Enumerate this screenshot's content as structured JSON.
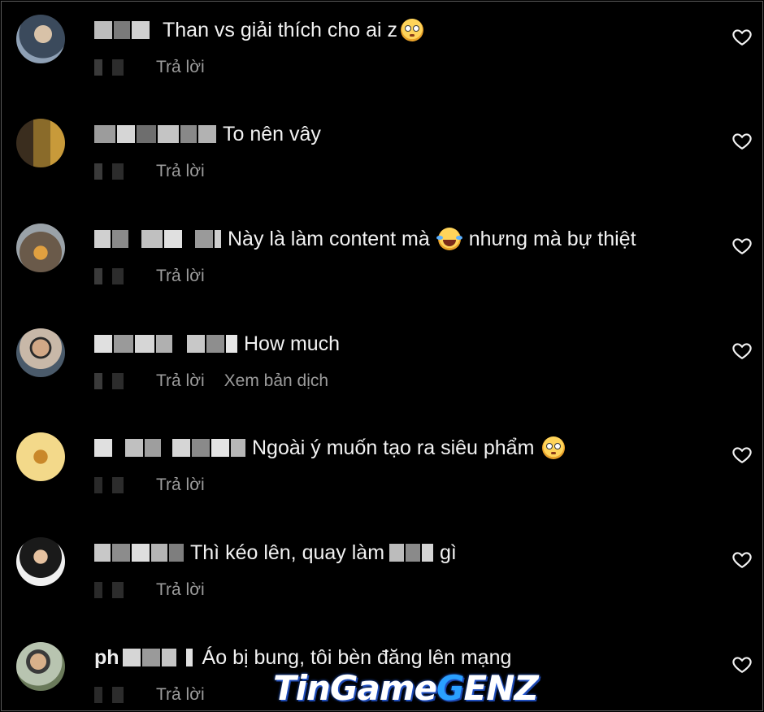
{
  "comments": [
    {
      "name_visible": "",
      "text_before": "Than vs giải thích cho ai z",
      "emoji": "flushed-face",
      "text_after": "",
      "reply": "Trả lời",
      "translate": ""
    },
    {
      "name_visible": "",
      "text_before": "To nên vây",
      "emoji": "",
      "text_after": "",
      "reply": "Trả lời",
      "translate": ""
    },
    {
      "name_visible": "",
      "text_before": "Này là làm content mà",
      "emoji": "laughing-tears-face",
      "text_after": "nhưng mà bự thiệt",
      "reply": "Trả lời",
      "translate": ""
    },
    {
      "name_visible": "",
      "text_before": "How much",
      "emoji": "",
      "text_after": "",
      "reply": "Trả lời",
      "translate": "Xem bản dịch"
    },
    {
      "name_visible": "",
      "text_before": "Ngoài ý muốn tạo ra siêu phẩm",
      "emoji": "flushed-face",
      "text_after": "",
      "reply": "Trả lời",
      "translate": ""
    },
    {
      "name_visible": "",
      "text_before": "Thì kéo lên, quay làm",
      "emoji": "",
      "censored": true,
      "text_after": "gì",
      "reply": "Trả lời",
      "translate": ""
    },
    {
      "name_visible": "ph",
      "text_before": "Áo bị bung, tôi bèn đăng lên mạng",
      "emoji": "",
      "text_after": "",
      "reply": "Trả lời",
      "translate": ""
    }
  ],
  "icons": {
    "like": "heart-outline-icon"
  },
  "watermark": {
    "part1": "TinGame",
    "part2": "G",
    "part3": "ENZ"
  },
  "colors": {
    "background": "#000000",
    "text": "#f2f2f2",
    "meta": "#9c9c9c",
    "watermark_accent": "#2aa0ff"
  }
}
